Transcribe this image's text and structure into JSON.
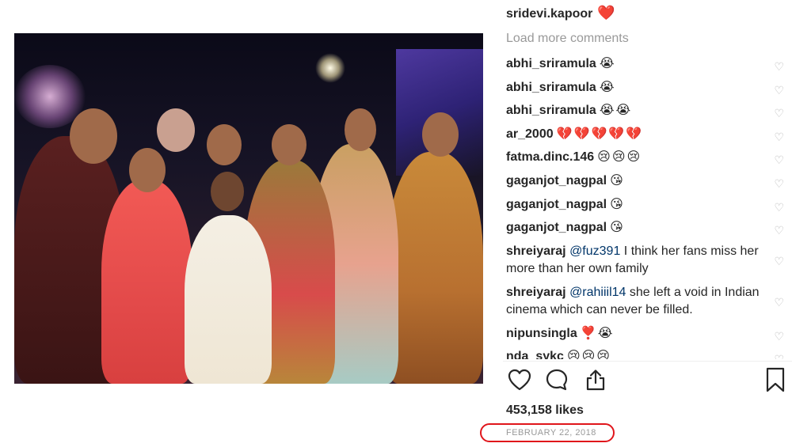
{
  "post": {
    "owner": "sridevi.kapoor",
    "owner_emoji": "❤️",
    "load_more_label": "Load more comments",
    "likes": "453,158 likes",
    "date": "FEBRUARY 22, 2018"
  },
  "comments": [
    {
      "user": "abhi_sriramula",
      "emojis": "😭"
    },
    {
      "user": "abhi_sriramula",
      "emojis": "😭"
    },
    {
      "user": "abhi_sriramula",
      "emojis": "😭😭"
    },
    {
      "user": "ar_2000",
      "emojis": "💔💔💔💔💔"
    },
    {
      "user": "fatma.dinc.146",
      "emojis": "😢😢😢"
    },
    {
      "user": "gaganjot_nagpal",
      "emojis": "😘"
    },
    {
      "user": "gaganjot_nagpal",
      "emojis": "😘"
    },
    {
      "user": "gaganjot_nagpal",
      "emojis": "😘"
    },
    {
      "user": "shreiyaraj",
      "mention": "@fuz391",
      "text": "I think her fans miss her more than her own family"
    },
    {
      "user": "shreiyaraj",
      "mention": "@rahiiil14",
      "text": "she left a void in Indian cinema which can never be filled."
    },
    {
      "user": "nipunsingla",
      "emojis": "❣️😭"
    },
    {
      "user": "nda_sykc",
      "emojis": "😢😢😢"
    }
  ],
  "icons": {
    "like": "heart-outline-icon",
    "comment": "speech-bubble-icon",
    "share": "share-icon",
    "save": "bookmark-icon"
  },
  "colors": {
    "text": "#262626",
    "muted": "#999999",
    "heart_red": "#e0252f",
    "annotation_ring": "#e0151b"
  }
}
